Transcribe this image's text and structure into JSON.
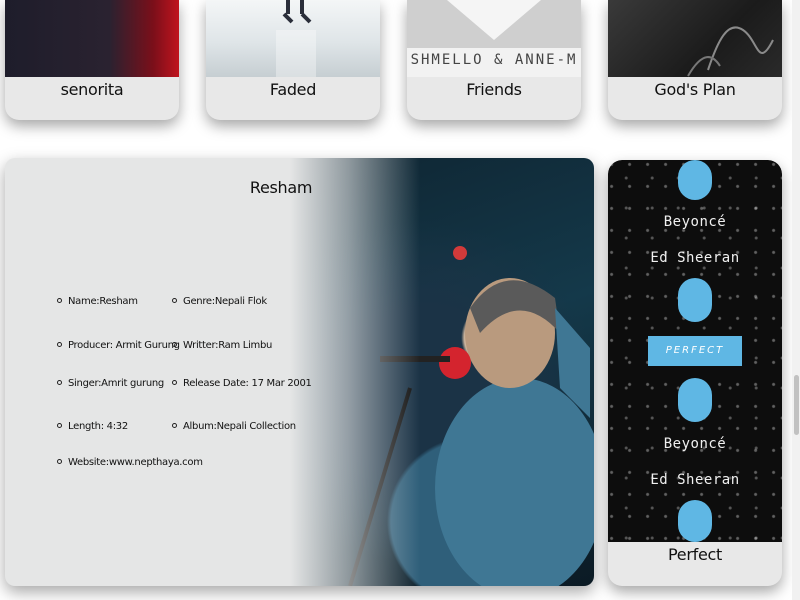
{
  "top_cards": [
    {
      "title": "senorita"
    },
    {
      "title": "Faded"
    },
    {
      "title": "Friends",
      "art_text": "SHMELLO & ANNE-M"
    },
    {
      "title": "God's Plan"
    }
  ],
  "detail": {
    "title": "Resham",
    "fields": {
      "name": "Name:Resham",
      "genre": "Genre:Nepali Flok",
      "producer": "Producer: Armit Gurung",
      "writter": "Writter:Ram Limbu",
      "singer": "Singer:Amrit gurung",
      "release": "Release Date: 17 Mar 2001",
      "length": "Length: 4:32",
      "album": "Album:Nepali Collection",
      "website": "Website:www.nepthaya.com"
    }
  },
  "perfect_card": {
    "title": "Perfect",
    "art_line1": "Beyoncé",
    "art_line2": "Ed Sheeran",
    "art_band": "PERFECT",
    "accent_color": "#5fb7e4"
  }
}
